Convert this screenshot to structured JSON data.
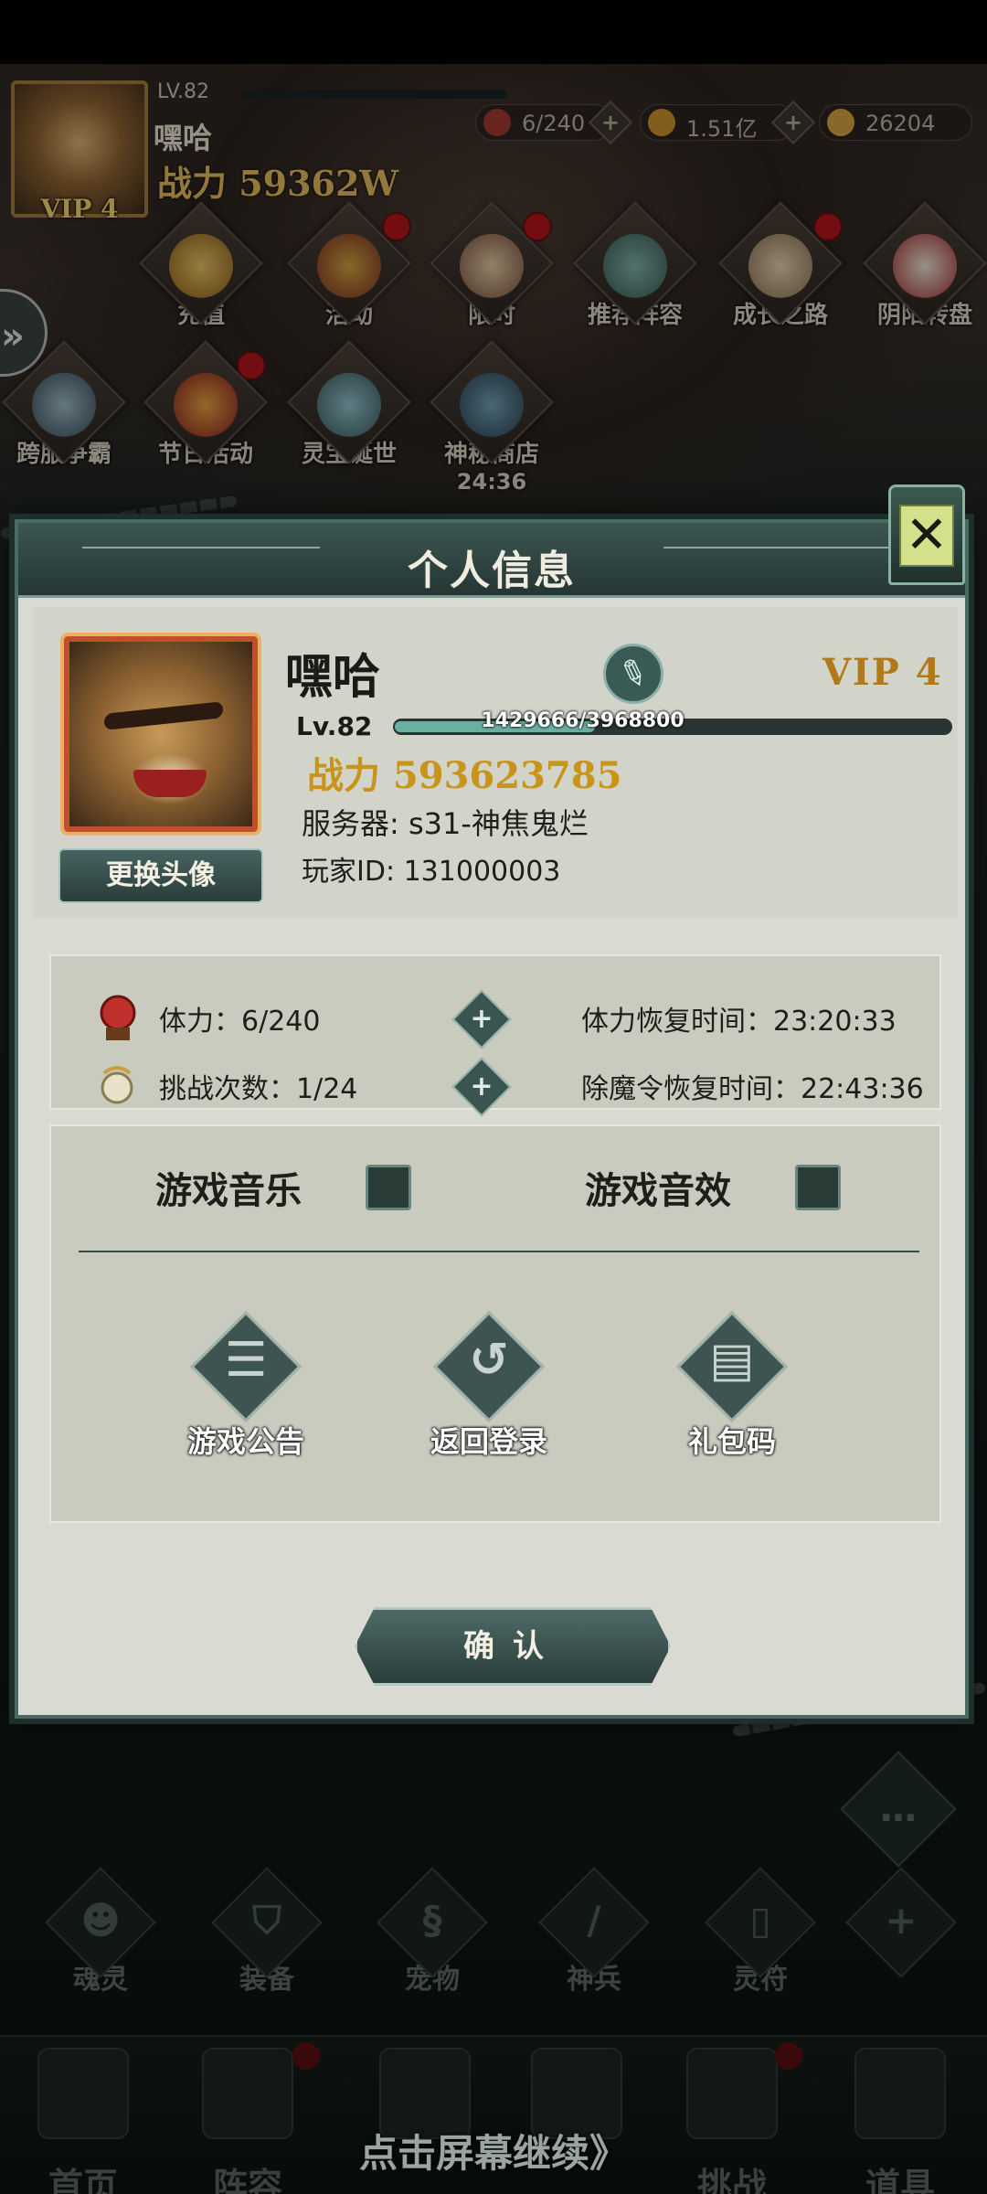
{
  "hud": {
    "level": "LV.82",
    "name": "嘿哈",
    "power": "战力 59362W",
    "vip": "VIP 4",
    "resources": [
      {
        "icon": "stamina-icon",
        "value": "6/240"
      },
      {
        "icon": "gold-coin-icon",
        "value": "1.51亿"
      },
      {
        "icon": "ingot-icon",
        "value": "26204"
      }
    ]
  },
  "menu": [
    {
      "name": "recharge",
      "label": "充值",
      "badge": false
    },
    {
      "name": "activity",
      "label": "活动",
      "badge": true
    },
    {
      "name": "limited",
      "label": "限时",
      "badge": true
    },
    {
      "name": "recommended-lineup",
      "label": "推荐阵容",
      "badge": false
    },
    {
      "name": "growth-path",
      "label": "成长之路",
      "badge": true
    },
    {
      "name": "yinyang-wheel",
      "label": "阴阳转盘",
      "badge": false
    },
    {
      "name": "cross-server",
      "label": "跨服争霸",
      "badge": false
    },
    {
      "name": "festival",
      "label": "节日活动",
      "badge": true
    },
    {
      "name": "spirit-treasure",
      "label": "灵宝诞世",
      "badge": false
    },
    {
      "name": "mystery-shop",
      "label": "神秘商店",
      "sub": "24:36",
      "badge": false
    }
  ],
  "dialog": {
    "title": "个人信息",
    "player_name": "嘿哈",
    "vip": "VIP 4",
    "level": "Lv.82",
    "xp_text": "1429666/3968800",
    "xp_fraction": 0.36,
    "power": "战力 593623785",
    "server": "服务器: s31-神焦鬼烂",
    "player_id": "玩家ID: 131000003",
    "change_avatar_label": "更换头像",
    "stats": [
      {
        "icon": "stamina-icon",
        "label": "体力：6/240",
        "right": "体力恢复时间：23:20:33"
      },
      {
        "icon": "challenge-icon",
        "label": "挑战次数：1/24",
        "right": "除魔令恢复时间：22:43:36"
      }
    ],
    "music_label": "游戏音乐",
    "sfx_label": "游戏音效",
    "actions": [
      {
        "name": "announcement",
        "label": "游戏公告",
        "glyph": "☰"
      },
      {
        "name": "return-login",
        "label": "返回登录",
        "glyph": "↺"
      },
      {
        "name": "gift-code",
        "label": "礼包码",
        "glyph": "▤"
      }
    ],
    "confirm_label": "确认"
  },
  "functions": [
    {
      "name": "soul",
      "label": "魂灵",
      "glyph": "☻"
    },
    {
      "name": "equipment",
      "label": "装备",
      "glyph": "⛉"
    },
    {
      "name": "pet",
      "label": "宠物",
      "glyph": "§"
    },
    {
      "name": "weapon",
      "label": "神兵",
      "glyph": "/"
    },
    {
      "name": "talisman",
      "label": "灵符",
      "glyph": "▯"
    },
    {
      "name": "more",
      "label": "",
      "glyph": "+"
    }
  ],
  "bottom_nav": [
    {
      "name": "home",
      "label": "首页",
      "badge": false
    },
    {
      "name": "lineup",
      "label": "阵容",
      "badge": true
    },
    {
      "name": "challenge",
      "label": "挑战",
      "badge": true
    },
    {
      "name": "items",
      "label": "道具",
      "badge": false
    }
  ],
  "tap_to_continue": "点击屏幕继续》"
}
